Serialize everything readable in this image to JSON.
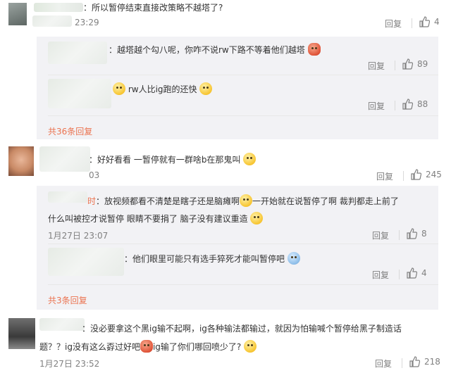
{
  "comments": [
    {
      "text": "：所以暂停结束直接改策略不越塔了?",
      "time": "23:29",
      "reply_label": "回复",
      "likes": "4",
      "replies": [
        {
          "text": "：越塔越个勾八呢，你咋不说rw下路不等着他们越塔",
          "reply_label": "回复",
          "likes": "89"
        },
        {
          "text": "rw人比ig跑的还快",
          "reply_label": "回复",
          "likes": "88"
        }
      ],
      "more_label": "共36条回复"
    },
    {
      "text": "：好好看看 一暂停就有一群啥b在那鬼叫",
      "time": "03",
      "reply_label": "回复",
      "likes": "245",
      "replies": [
        {
          "name_suffix": "时",
          "text_line1": "：放视频都看不清楚是瞎子还是脑瘫啊",
          "text_line1b": "一开始就在说暂停了啊 裁判都走上前了",
          "text_line2": "什么叫被控才说暂停 眼睛不要捐了 脑子没有建议重造",
          "time": "1月27日 23:07",
          "reply_label": "回复",
          "likes": "8"
        },
        {
          "text": "：他们眼里可能只有选手猝死才能叫暂停吧",
          "reply_label": "回复",
          "likes": "4"
        }
      ],
      "more_label": "共3条回复"
    },
    {
      "text_line1": "：没必要拿这个黑ig输不起啊，ig各种输法都输过，就因为怕输喊个暂停给黑子制造话",
      "text_line2a": "题？？ig没有这么孬过好吧",
      "text_line2b": "ig输了你们哪回喷少了?",
      "time": "1月27日 23:52",
      "reply_label": "回复",
      "likes": "218"
    }
  ],
  "icons": {
    "like": "thumbs-up-icon",
    "emoji_crab": "crab-emoji-icon",
    "emoji_blush": "blush-emoji-icon",
    "emoji_yawn": "yawn-emoji-icon",
    "emoji_cry": "crying-emoji-icon",
    "emoji_think": "thinking-emoji-icon",
    "emoji_smile": "smile-emoji-icon",
    "emoji_shock": "shocked-emoji-icon"
  },
  "colors": {
    "accent": "#eb7350",
    "reply_bg": "#f2f2f5",
    "meta_text": "#808080"
  }
}
